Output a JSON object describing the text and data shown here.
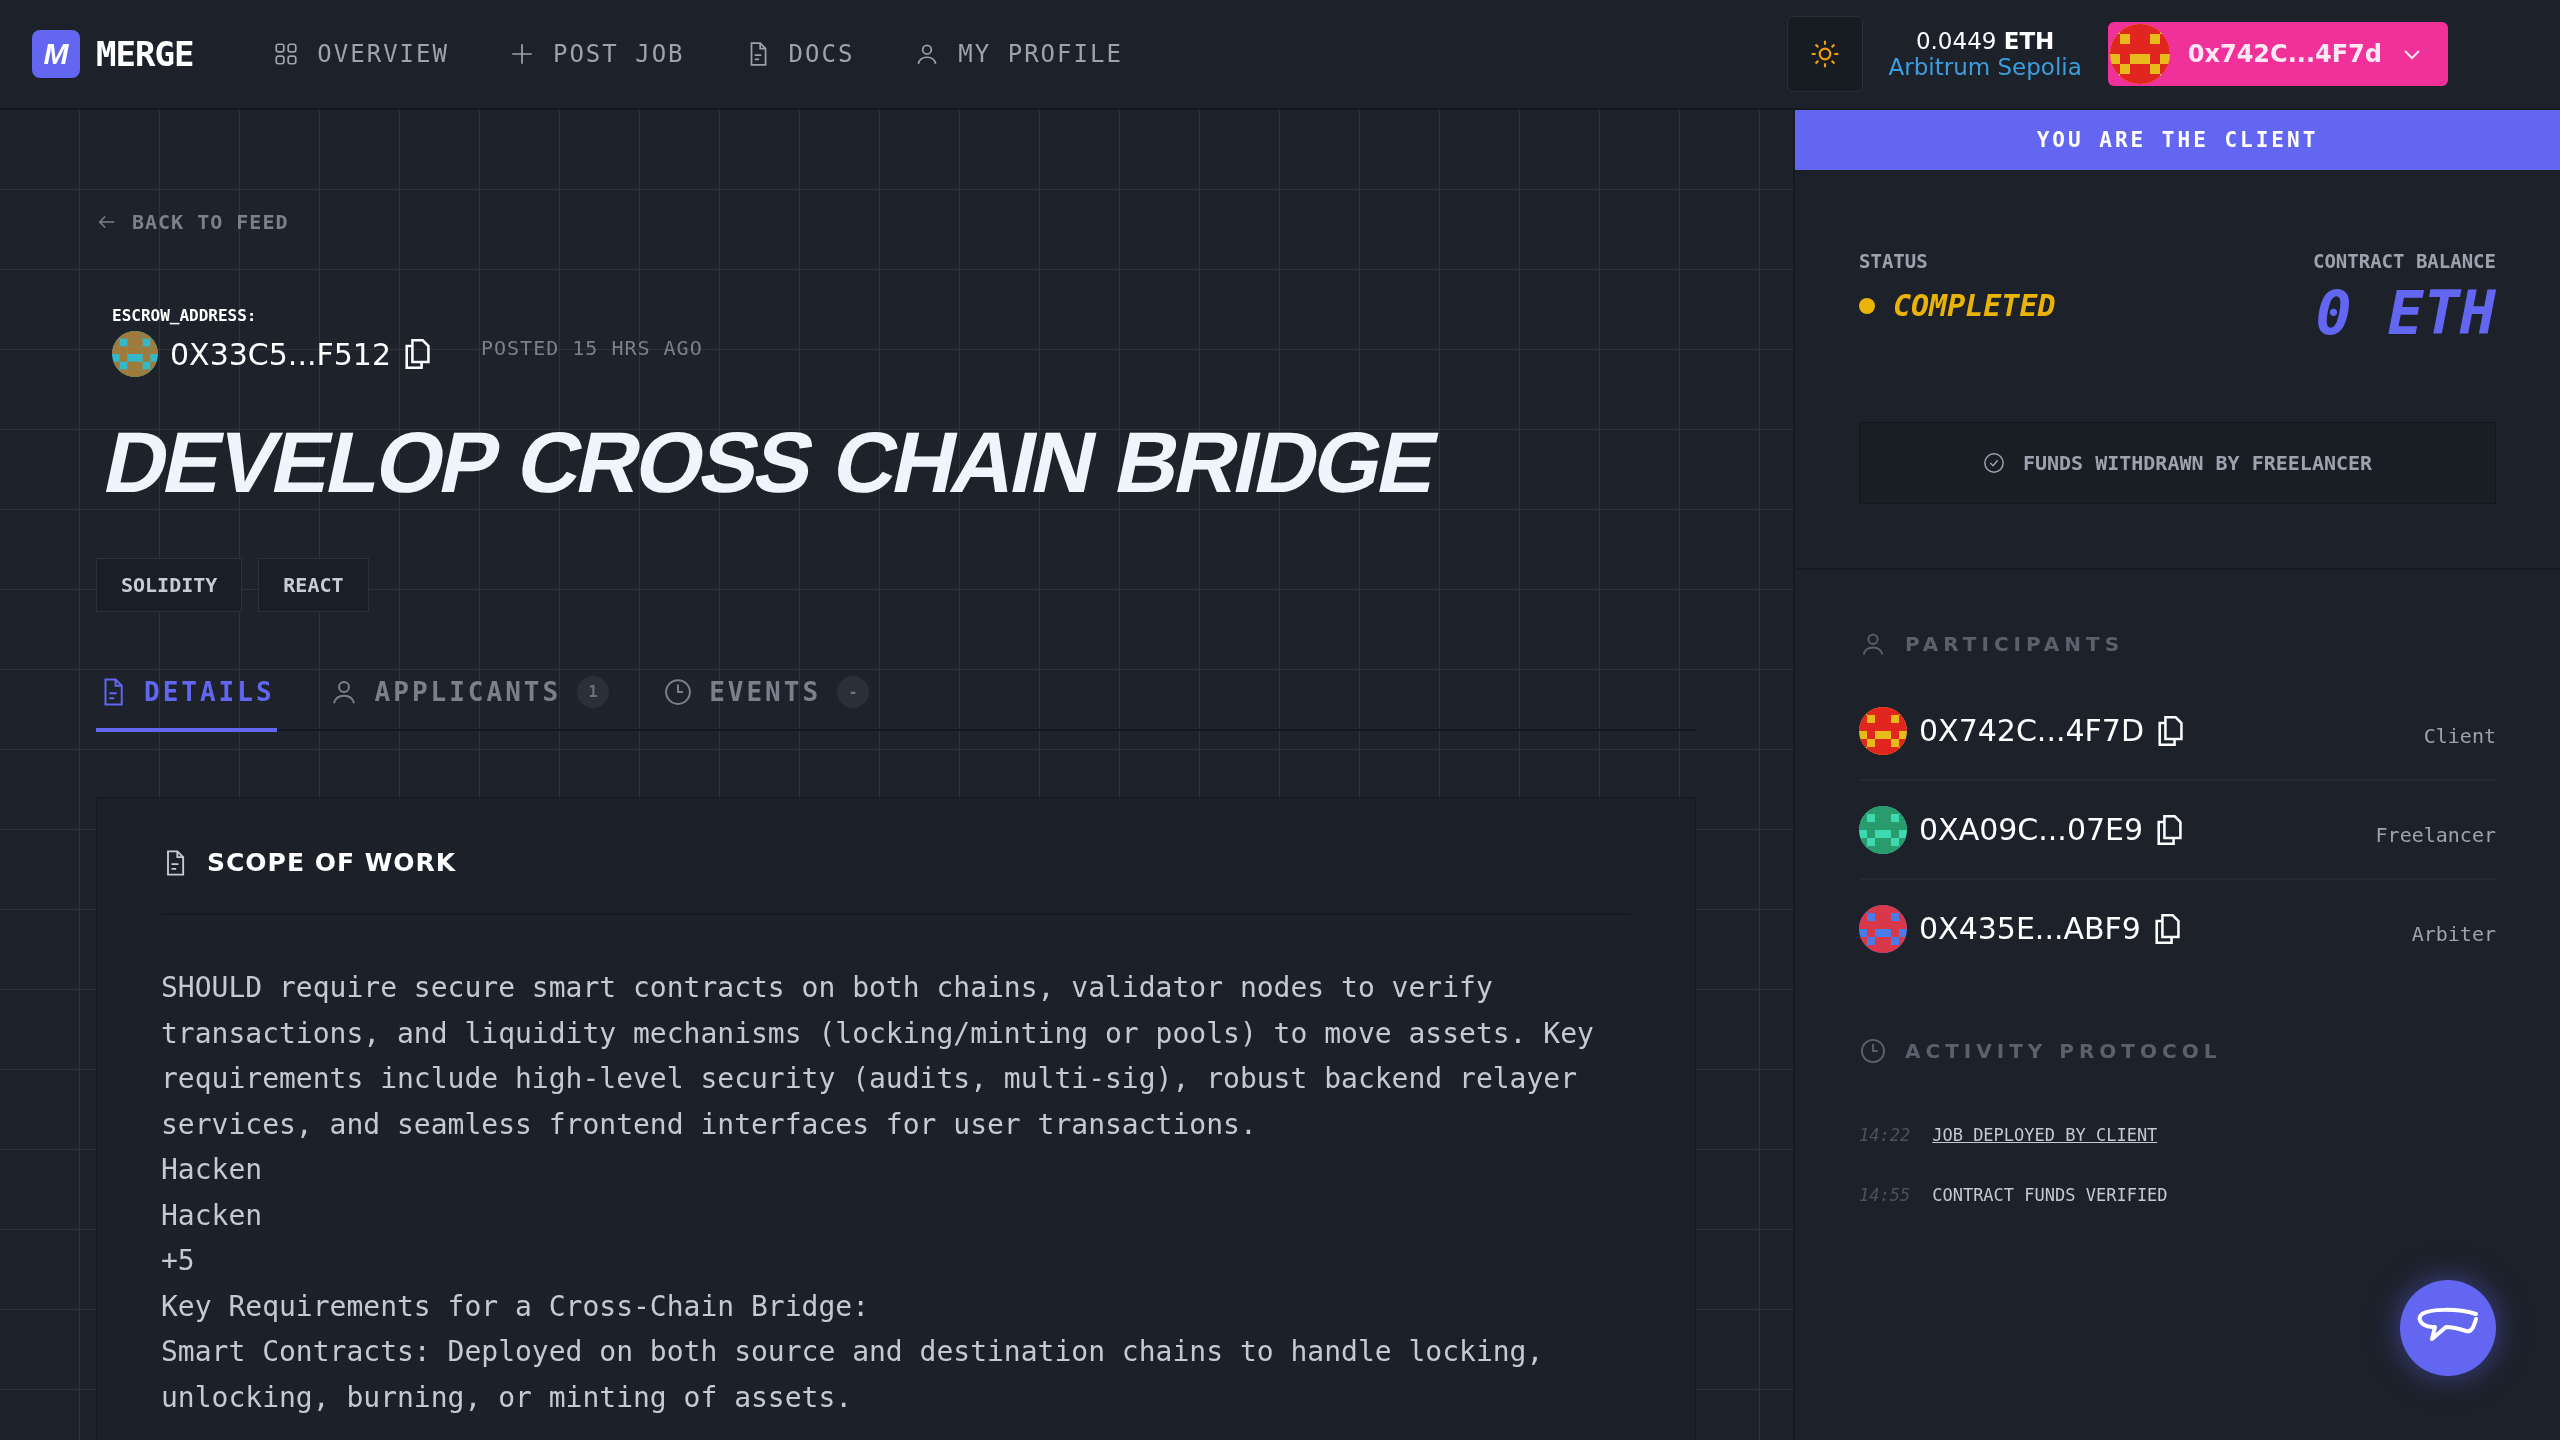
{
  "header": {
    "logo_mark": "M",
    "brand": "MERGE",
    "nav": [
      {
        "kind": "grid",
        "label": "OVERVIEW"
      },
      {
        "kind": "plus",
        "label": "POST JOB"
      },
      {
        "kind": "doc",
        "label": "DOCS"
      },
      {
        "kind": "user",
        "label": "MY PROFILE"
      }
    ],
    "balance": {
      "amount": "0.0449",
      "unit": "ETH",
      "network": "Arbitrum Sepolia"
    },
    "wallet": {
      "address": "0x742C...4F7d"
    }
  },
  "back_link": "BACK TO FEED",
  "escrow": {
    "label": "ESCROW_ADDRESS:",
    "address": "0X33C5...F512",
    "posted": "POSTED 15 HRS AGO"
  },
  "title": "DEVELOP CROSS CHAIN BRIDGE",
  "tags": [
    "SOLIDITY",
    "REACT"
  ],
  "tabs": [
    {
      "kind": "doc",
      "label": "DETAILS",
      "selected": true
    },
    {
      "kind": "user",
      "label": "APPLICANTS",
      "count": "1",
      "selected": false
    },
    {
      "kind": "clock",
      "label": "EVENTS",
      "count": "-",
      "selected": false
    }
  ],
  "scope": {
    "heading": "SCOPE OF WORK",
    "lines": [
      "SHOULD require secure smart contracts on both chains, validator nodes to verify transactions, and liquidity mechanisms (locking/minting or pools) to move assets. Key requirements include high-level security (audits, multi-sig), robust backend relayer services, and seamless frontend interfaces for user transactions.",
      "Hacken",
      "Hacken",
      "+5",
      "Key Requirements for a Cross-Chain Bridge:",
      "Smart Contracts: Deployed on both source and destination chains to handle locking, unlocking, burning, or minting of assets."
    ]
  },
  "role_banner": "YOU ARE THE CLIENT",
  "status": {
    "label": "STATUS",
    "value": "COMPLETED"
  },
  "contract_balance": {
    "label": "CONTRACT BALANCE",
    "value": "0 ETH"
  },
  "funds_notice": "FUNDS WITHDRAWN BY FREELANCER",
  "participants": {
    "heading": "PARTICIPANTS",
    "items": [
      {
        "address": "0X742C...4F7D",
        "role": "Client"
      },
      {
        "address": "0XA09C...07E9",
        "role": "Freelancer"
      },
      {
        "address": "0X435E...ABF9",
        "role": "Arbiter"
      }
    ]
  },
  "activity": {
    "heading": "ACTIVITY PROTOCOL",
    "events": [
      {
        "time": "14:22",
        "text": "JOB DEPLOYED BY CLIENT",
        "kind": "link"
      },
      {
        "time": "14:55",
        "text": "CONTRACT FUNDS VERIFIED",
        "kind": "plain"
      }
    ]
  }
}
